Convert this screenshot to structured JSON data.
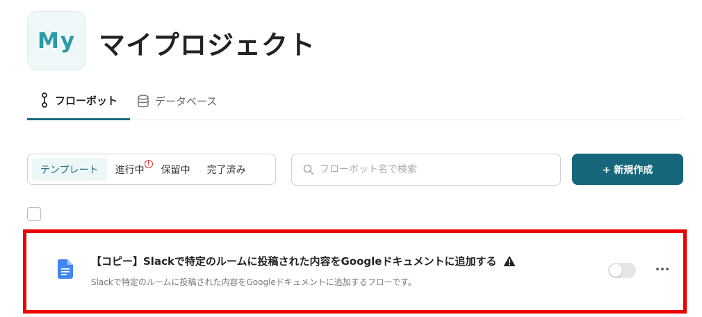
{
  "project": {
    "avatar_text": "My",
    "title": "マイプロジェクト"
  },
  "tabs": [
    {
      "label": "フローボット",
      "icon": "flowbot-icon",
      "active": true
    },
    {
      "label": "データベース",
      "icon": "database-icon",
      "active": false
    }
  ],
  "filters": [
    {
      "label": "テンプレート",
      "active": true
    },
    {
      "label": "進行中",
      "badge": "!"
    },
    {
      "label": "保留中"
    },
    {
      "label": "完了済み"
    }
  ],
  "search": {
    "placeholder": "フローボット名で検索"
  },
  "new_button": {
    "label": "+ 新規作成"
  },
  "flows": [
    {
      "icon": "google-docs-icon",
      "title": "【コピー】Slackで特定のルームに投稿された内容をGoogleドキュメントに追加する",
      "warning_icon": "warning-icon",
      "description": "Slackで特定のルームに投稿された内容をGoogleドキュメントに追加するフローです。",
      "enabled": false
    }
  ],
  "colors": {
    "accent": "#16677c",
    "highlight": "#ee0000"
  }
}
